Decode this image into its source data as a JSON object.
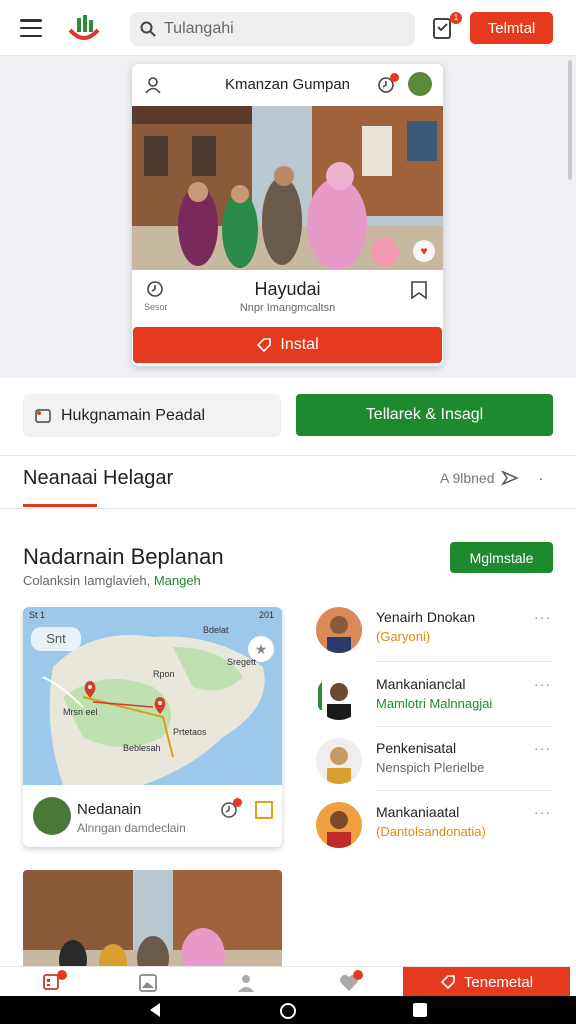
{
  "header": {
    "search_placeholder": "Tulangahi",
    "cart_badge": "1",
    "primary_button": "Telmtal",
    "colors": {
      "accent": "#e53a1e",
      "green": "#1e8a2e"
    }
  },
  "hero_card": {
    "title": "Kmanzan Gumpan",
    "notify_badge": "1",
    "tiny_label": "Sesor",
    "name": "Hayudai",
    "subtitle": "Nnpr Imangmcaltsn",
    "install_label": "Instal"
  },
  "actions": {
    "pill_label": "Hukgnamain Peadal",
    "green_button": "Tellarek & Insagl"
  },
  "section": {
    "title": "Neanaai Helagar",
    "right_label": "A 9lbned"
  },
  "recommend": {
    "title": "Nadarnain Beplanan",
    "subtitle_prefix": "Colanksin Iamglavieh,",
    "subtitle_highlight": "Mangeh",
    "button": "Mglmstale"
  },
  "map_card": {
    "status_left": "St 1",
    "status_right": "201",
    "chip": "Snt",
    "labels": [
      "Bdelat",
      "Sregett",
      "Rpon",
      "Mrsn eel",
      "Beblesah",
      "Prtetaos"
    ],
    "name": "Nedanain",
    "subtitle": "Alnngan damdeclain",
    "badge": "1"
  },
  "people": [
    {
      "name": "Yenairh Dnokan",
      "sub": "(Garyoni)",
      "sub_color": "#e08a10"
    },
    {
      "name": "Mankanianclal",
      "sub": "Mamlotri Malnnagjai",
      "sub_color": "#1e8a2e"
    },
    {
      "name": "Penkenisatal",
      "sub": "Nenspich Plerielbe",
      "sub_color": "#666666"
    },
    {
      "name": "Mankaniaatal",
      "sub": "(Dantolsandonatia)",
      "sub_color": "#e08a10"
    }
  ],
  "bottom_nav": {
    "cta": "Tenemetal",
    "heart_badge": "1",
    "home_badge": "1"
  },
  "icons": [
    "hamburger-icon",
    "logo-icon",
    "search-icon",
    "cart-icon",
    "users-icon",
    "bell-icon",
    "clock-icon",
    "bookmark-icon",
    "tag-icon",
    "heart-icon",
    "share-icon",
    "more-icon",
    "pin-icon",
    "grid-icon",
    "profile-icon",
    "back-icon",
    "home-circle-icon",
    "square-icon"
  ]
}
